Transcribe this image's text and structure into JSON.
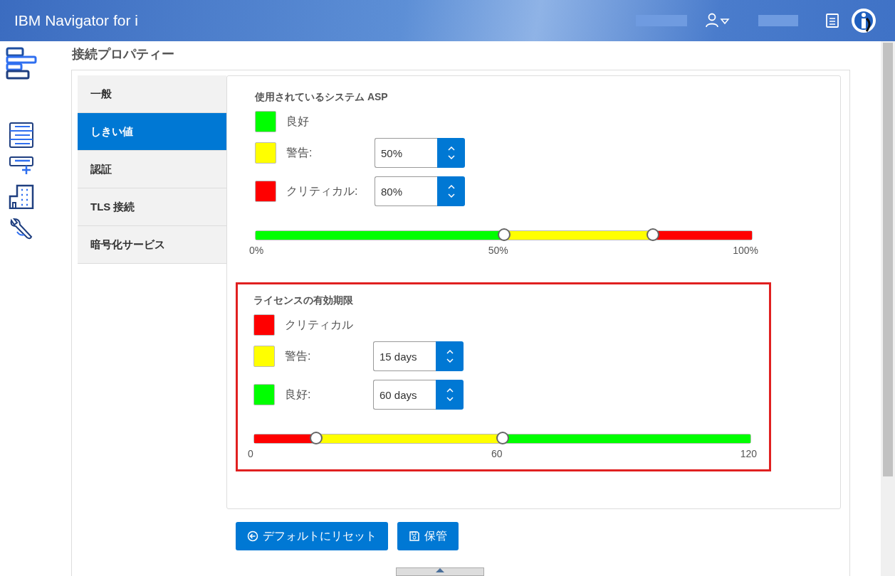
{
  "header": {
    "title": "IBM Navigator for i"
  },
  "page_title": "接続プロパティー",
  "tabs": [
    {
      "label": "一般",
      "selected": false
    },
    {
      "label": "しきい値",
      "selected": true
    },
    {
      "label": "認証",
      "selected": false
    },
    {
      "label": "TLS 接続",
      "selected": false
    },
    {
      "label": "暗号化サービス",
      "selected": false
    }
  ],
  "sections": [
    {
      "title": "使用されているシステム ASP",
      "highlighted": false,
      "rows": [
        {
          "label": "良好",
          "color": "#00ff00"
        },
        {
          "label": "警告:",
          "color": "#ffff00",
          "value": "50%"
        },
        {
          "label": "クリティカル:",
          "color": "#ff0000",
          "value": "80%"
        }
      ],
      "slider": {
        "thumbs": [
          {
            "level": 0.5
          },
          {
            "level": 0.8
          }
        ],
        "ticks": [
          "0%",
          "50%",
          "100%"
        ]
      }
    },
    {
      "title": "ライセンスの有効期限",
      "highlighted": true,
      "rows": [
        {
          "label": "クリティカル",
          "color": "#ff0000"
        },
        {
          "label": "警告:",
          "color": "#ffff00",
          "value": "15 days"
        },
        {
          "label": "良好:",
          "color": "#00ff00",
          "value": "60 days"
        }
      ],
      "slider": {
        "thumbs": [
          {
            "level": 0.125
          },
          {
            "level": 0.5
          }
        ],
        "ticks": [
          "0",
          "60",
          "120"
        ]
      }
    }
  ],
  "buttons": [
    {
      "label": "デフォルトにリセット",
      "kind": "reset"
    },
    {
      "label": "保管",
      "kind": "save"
    }
  ]
}
